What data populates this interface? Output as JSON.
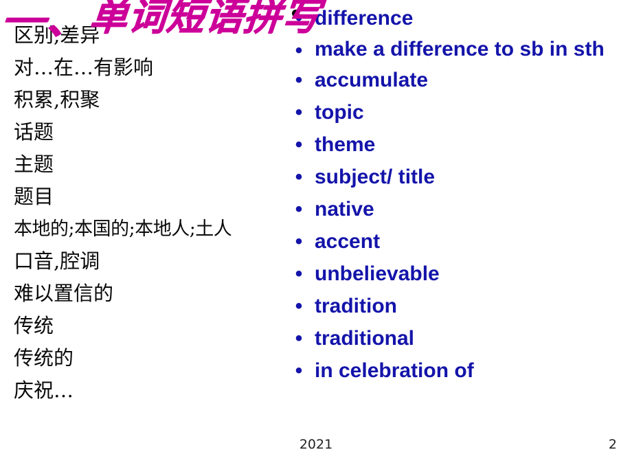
{
  "slide": {
    "title_lead": "一、",
    "title_main": "单词短语拼写",
    "title_color": "#CC0099",
    "english_color": "#1414AA",
    "background": "#FFFFFF"
  },
  "chinese": [
    {
      "text": "区别,差异"
    },
    {
      "text": "对…在…有影响"
    },
    {
      "text": "积累,积聚"
    },
    {
      "text": "话题"
    },
    {
      "text": "主题"
    },
    {
      "text": "题目"
    },
    {
      "text": "本地的;本国的;本地人;土人"
    },
    {
      "text": "口音,腔调"
    },
    {
      "text": "难以置信的"
    },
    {
      "text": "传统"
    },
    {
      "text": "传统的"
    },
    {
      "text": "庆祝…"
    }
  ],
  "english": [
    {
      "bullet": "•",
      "text": "difference"
    },
    {
      "bullet": "•",
      "text": "make a difference to sb in sth"
    },
    {
      "bullet": "•",
      "text": "accumulate"
    },
    {
      "bullet": "•",
      "text": "topic"
    },
    {
      "bullet": "•",
      "text": "theme"
    },
    {
      "bullet": "•",
      "text": "subject/ title"
    },
    {
      "bullet": "•",
      "text": "native"
    },
    {
      "bullet": "•",
      "text": "accent"
    },
    {
      "bullet": "•",
      "text": "unbelievable"
    },
    {
      "bullet": "•",
      "text": "tradition"
    },
    {
      "bullet": "•",
      "text": "traditional"
    },
    {
      "bullet": "•",
      "text": "in celebration of"
    }
  ],
  "footer": {
    "year": "2021",
    "page_number": "2"
  }
}
